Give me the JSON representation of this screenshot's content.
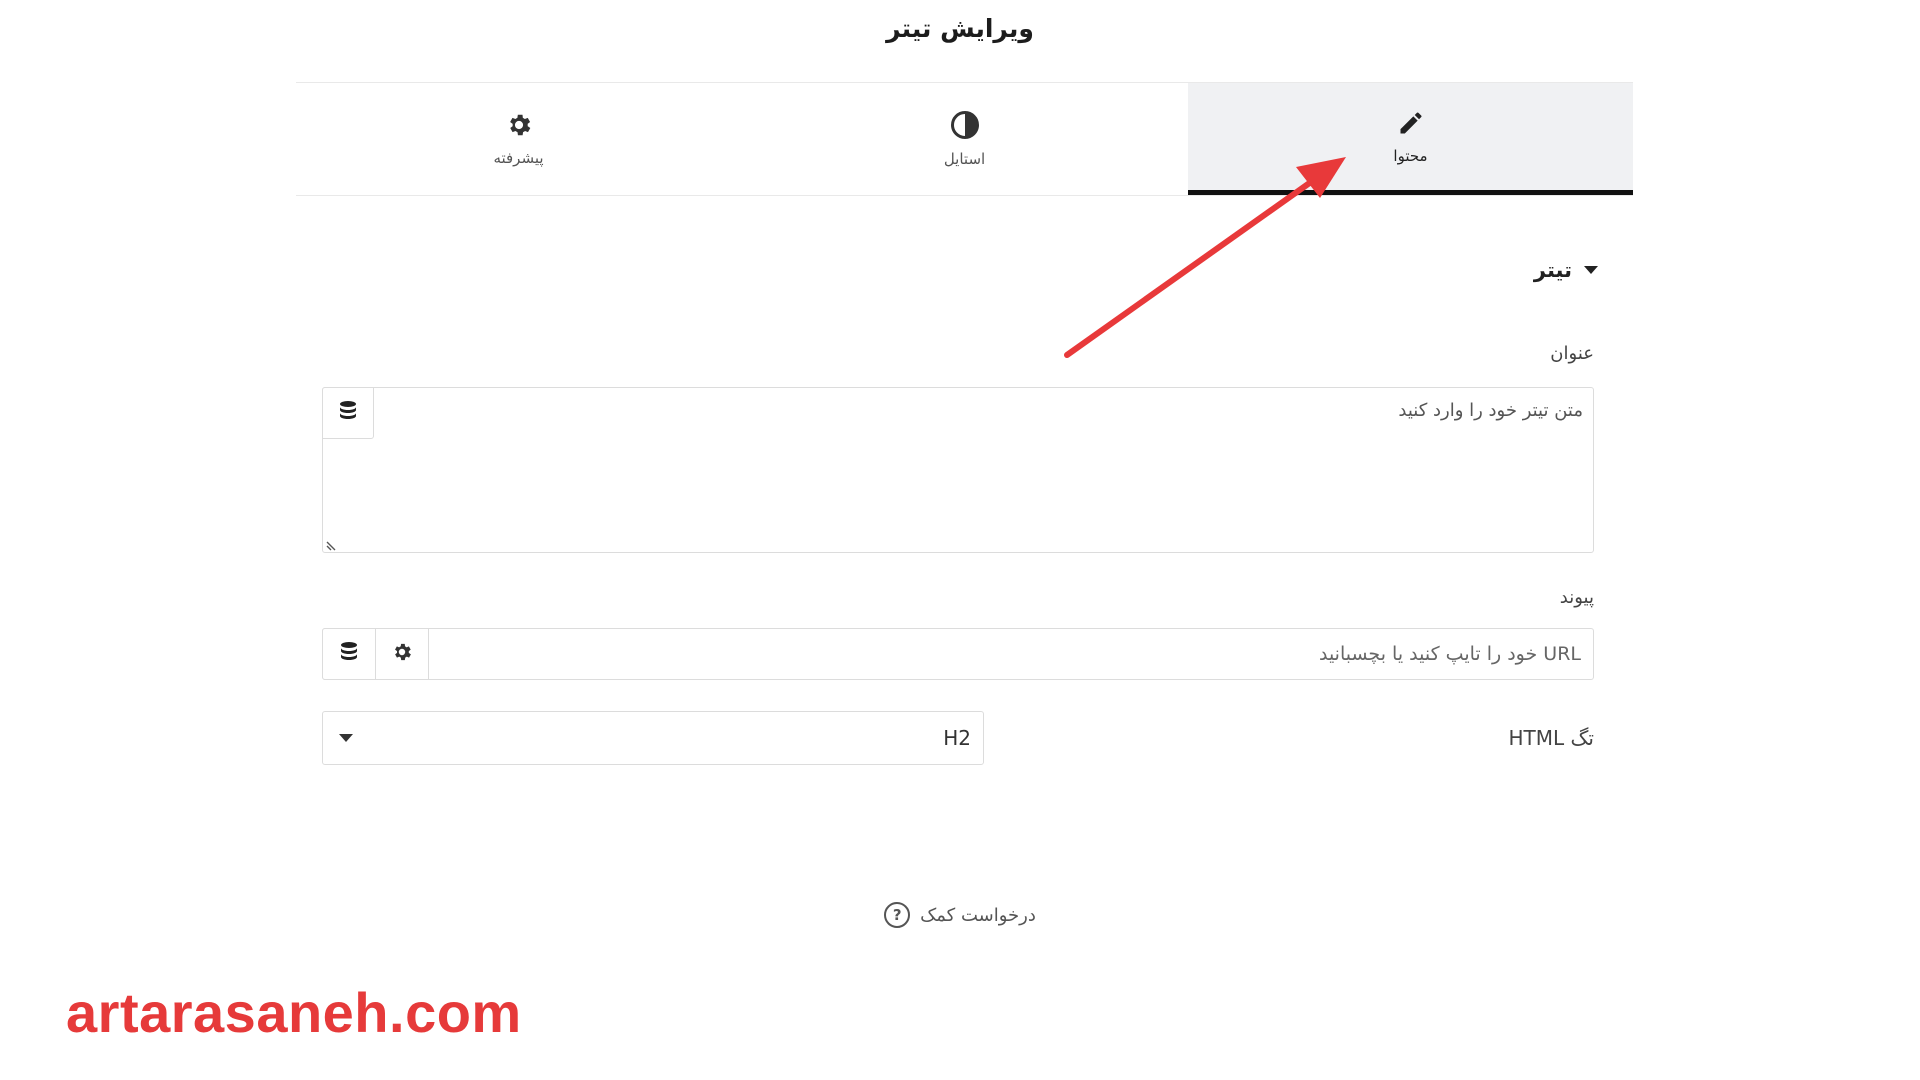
{
  "panel": {
    "title": "ویرایش تیتر"
  },
  "tabs": [
    {
      "label": "محتوا",
      "icon": "pencil-icon",
      "active": true
    },
    {
      "label": "استایل",
      "icon": "half-circle-icon",
      "active": false
    },
    {
      "label": "پیشرفته",
      "icon": "gear-icon",
      "active": false
    }
  ],
  "section": {
    "title": "تیتر",
    "icon": "caret-down-icon"
  },
  "fields": {
    "title_label": "عنوان",
    "title_placeholder": "متن تیتر خود را وارد کنید",
    "link_label": "پیوند",
    "link_placeholder": "URL خود را تایپ کنید یا بچسبانید",
    "tag_label": "تگ HTML",
    "tag_value": "H2"
  },
  "footer": {
    "help_label": "درخواست کمک",
    "help_icon": "question-circle-icon"
  },
  "watermark": {
    "text": "artarasaneh.com",
    "color": "#e63a3a"
  },
  "annotation": {
    "arrow_color": "#e8393a"
  }
}
